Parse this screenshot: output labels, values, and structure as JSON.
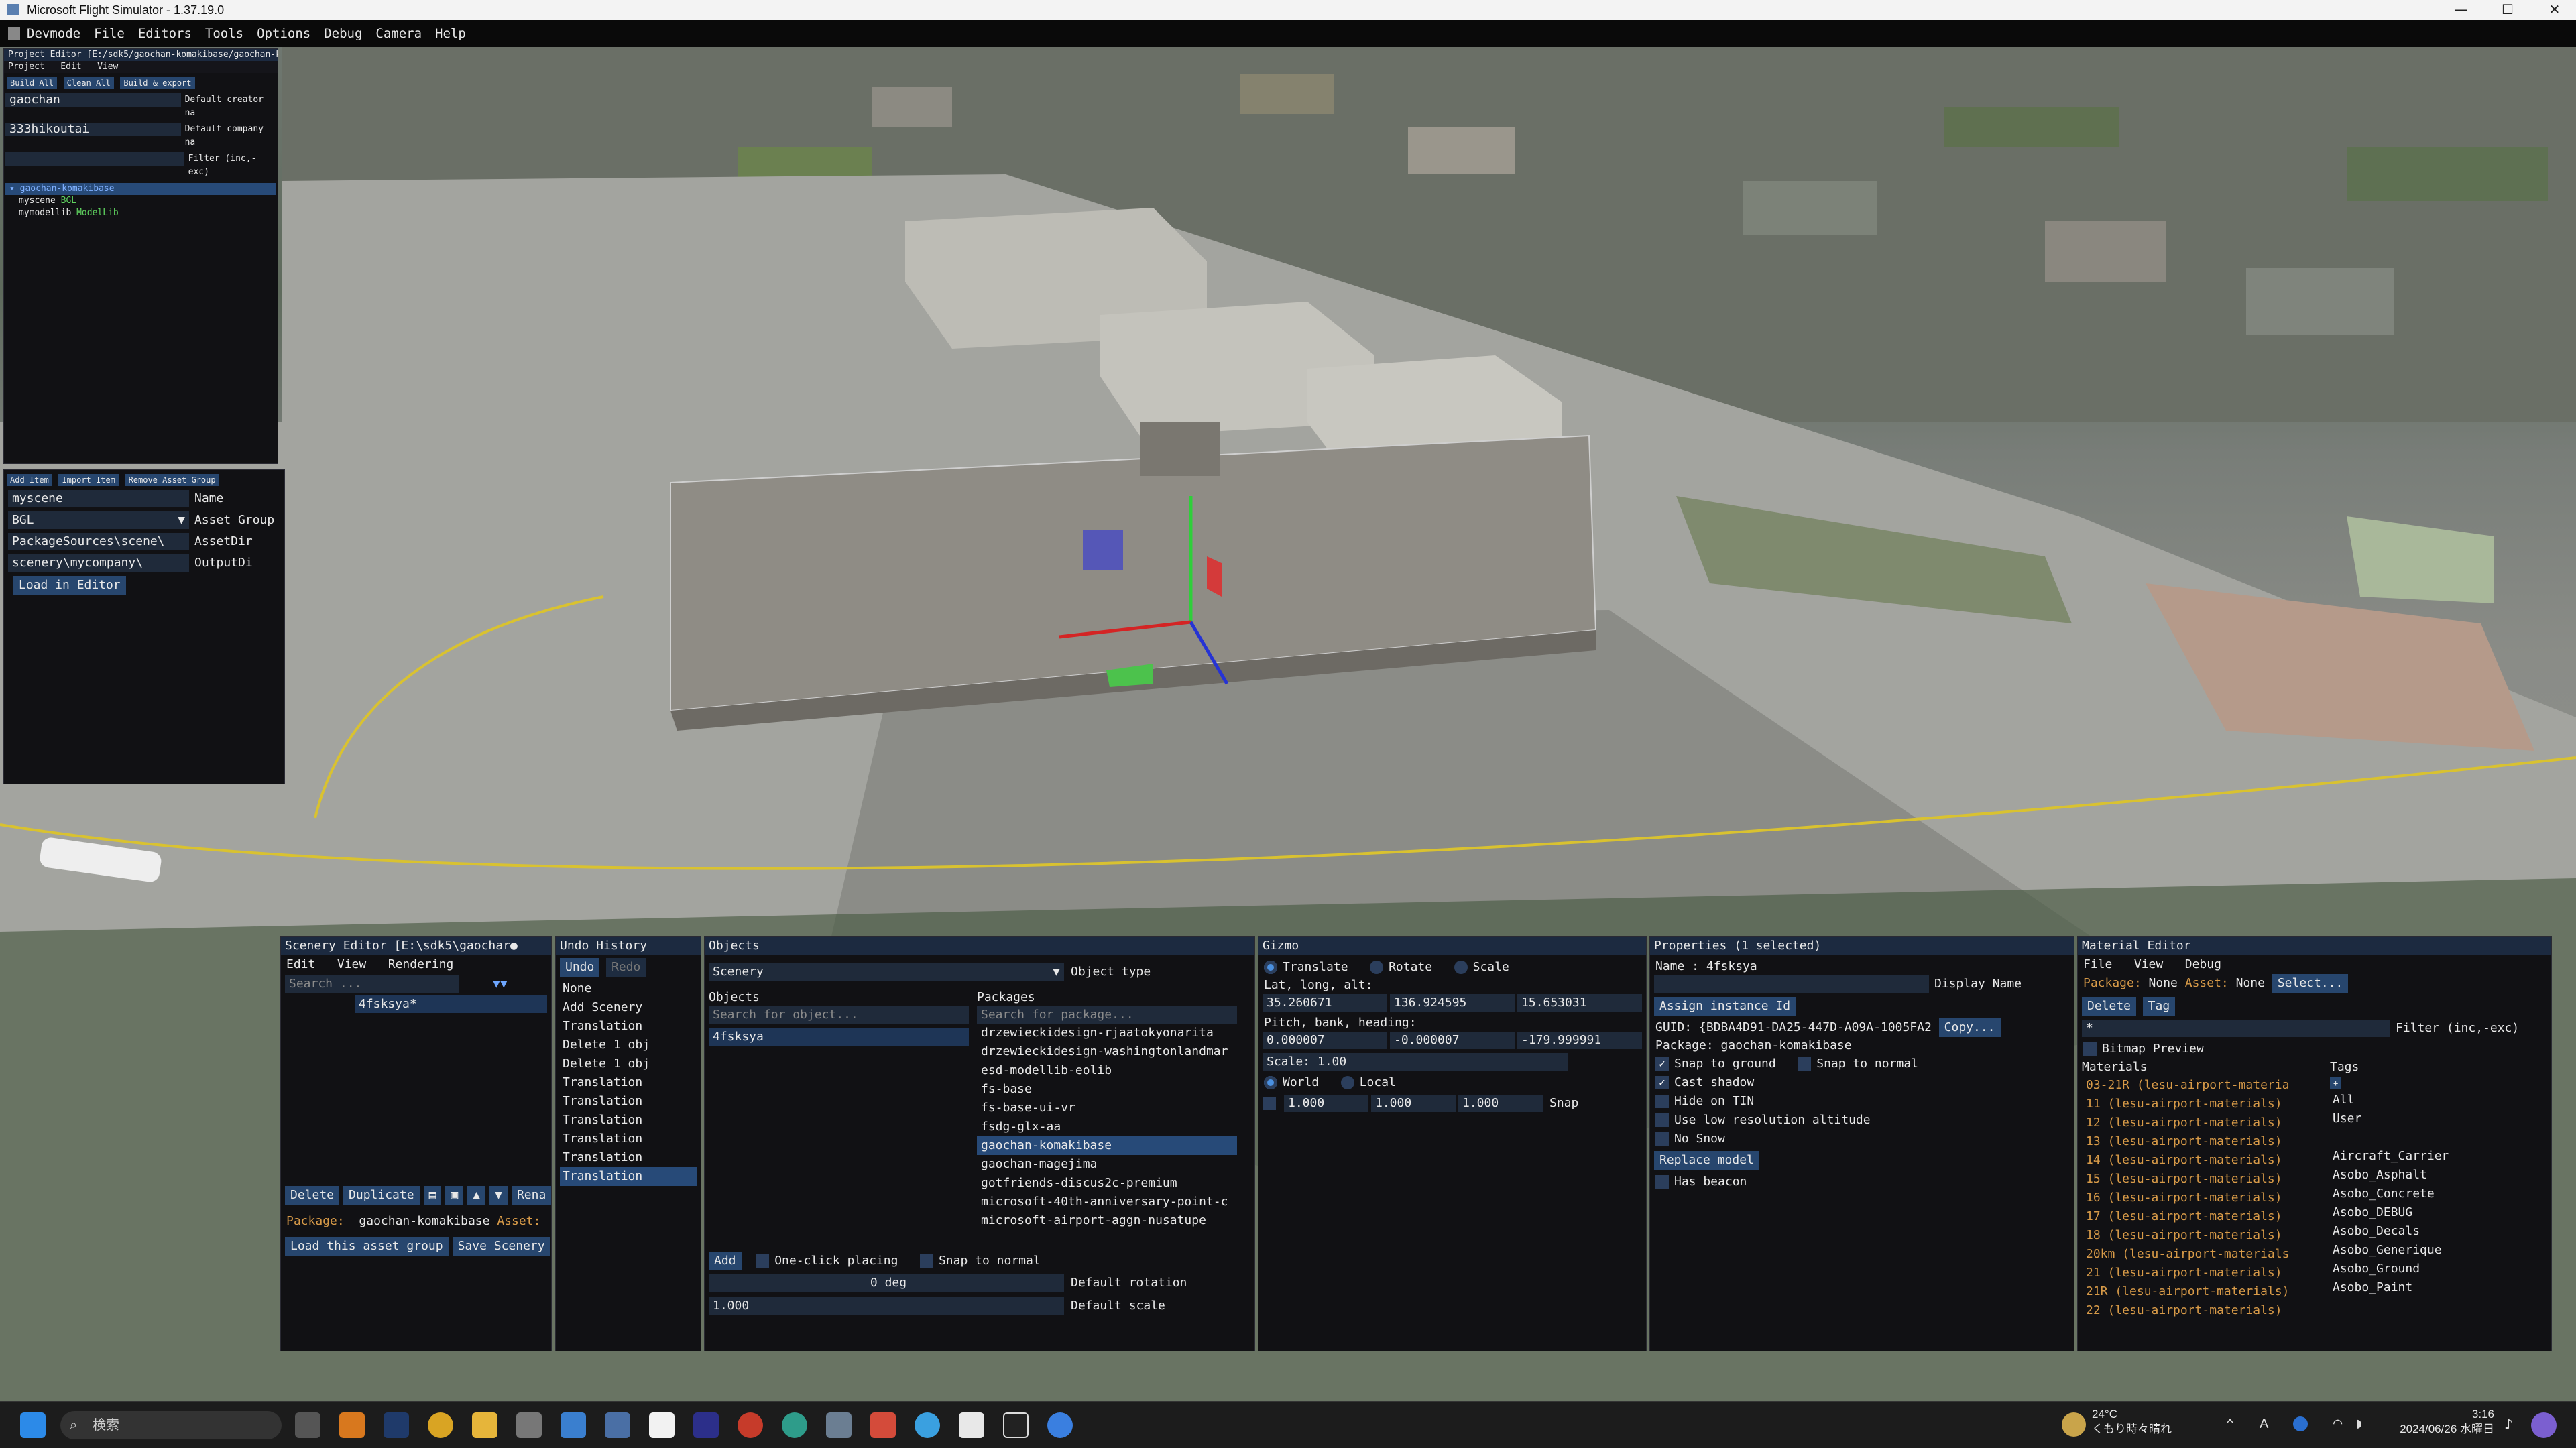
{
  "window": {
    "title": "Microsoft Flight Simulator - 1.37.19.0",
    "min": "—",
    "max": "☐",
    "close": "✕"
  },
  "menu": [
    "Devmode",
    "File",
    "Editors",
    "Tools",
    "Options",
    "Debug",
    "Camera",
    "Help"
  ],
  "project_editor": {
    "title": "Project Editor [E:/sdk5/gaochan-komakibase/gaochan-k",
    "menu": [
      "Project",
      "Edit",
      "View"
    ],
    "buttons": [
      "Build All",
      "Clean All",
      "Build & export"
    ],
    "fields": [
      {
        "value": "gaochan",
        "label": "Default creator na"
      },
      {
        "value": "333hikoutai",
        "label": "Default company na"
      },
      {
        "value": "",
        "label": "Filter (inc,-exc)"
      }
    ],
    "tree": [
      {
        "label": "gaochan-komakibase",
        "tag": ""
      },
      {
        "label": "myscene",
        "tag": "BGL"
      },
      {
        "label": "mymodellib",
        "tag": "ModelLib"
      }
    ],
    "asset_buttons": [
      "Add Item",
      "Import Item",
      "Remove Asset Group"
    ],
    "asset_fields": [
      {
        "value": "myscene",
        "label": "Name"
      },
      {
        "value": "BGL",
        "label": "Asset Group"
      },
      {
        "value": "PackageSources\\scene\\",
        "label": "AssetDir"
      },
      {
        "value": "scenery\\mycompany\\",
        "label": "OutputDi"
      }
    ],
    "load_button": "Load in Editor"
  },
  "scenery_editor": {
    "title": "Scenery Editor [E:\\sdk5\\gaochar●",
    "menu": [
      "Edit",
      "View",
      "Rendering"
    ],
    "search_placeholder": "Search ...",
    "item": "4fsksya*",
    "buttons": [
      "Delete",
      "Duplicate",
      "Rena"
    ],
    "package_label": "Package:",
    "package": "gaochan-komakibase",
    "asset_label": "Asset:",
    "load_button": "Load this asset group",
    "save_button": "Save Scenery"
  },
  "undo_history": {
    "title": "Undo History",
    "undo": "Undo",
    "redo": "Redo",
    "items": [
      "None",
      "Add Scenery",
      "Translation",
      "Delete 1 obj",
      "Delete 1 obj",
      "Translation",
      "Translation",
      "Translation",
      "Translation",
      "Translation",
      "Translation"
    ]
  },
  "objects": {
    "title": "Objects",
    "type_value": "Scenery",
    "type_label": "Object type",
    "objects_header": "Objects",
    "packages_header": "Packages",
    "obj_search": "Search for object...",
    "pkg_search": "Search for package...",
    "objects_list": [
      "4fsksya"
    ],
    "packages": [
      "drzewieckidesign-rjaatokyonarita",
      "drzewieckidesign-washingtonlandmar",
      "esd-modellib-eolib",
      "fs-base",
      "fs-base-ui-vr",
      "fsdg-glx-aa",
      "gaochan-komakibase",
      "gaochan-magejima",
      "gotfriends-discus2c-premium",
      "microsoft-40th-anniversary-point-c",
      "microsoft-airport-aggn-nusatupe"
    ],
    "add": "Add",
    "one_click": "One-click placing",
    "snap_normal": "Snap to normal",
    "rotation_value": "0 deg",
    "rotation_label": "Default rotation",
    "scale_value": "1.000",
    "scale_label": "Default scale"
  },
  "gizmo": {
    "title": "Gizmo",
    "modes": [
      "Translate",
      "Rotate",
      "Scale"
    ],
    "lla_label": "Lat, long, alt:",
    "lla": [
      "35.260671",
      "136.924595",
      "15.653031"
    ],
    "pbh_label": "Pitch, bank, heading:",
    "pbh": [
      "0.000007",
      "-0.000007",
      "-179.999991"
    ],
    "scale": "Scale: 1.00",
    "spaces": [
      "World",
      "Local"
    ],
    "snap": [
      "1.000",
      "1.000",
      "1.000"
    ],
    "snap_label": "Snap"
  },
  "properties": {
    "title": "Properties (1 selected)",
    "name": "Name : 4fsksya",
    "display_label": "Display Name",
    "assign_button": "Assign instance Id",
    "guid": "GUID: {BDBA4D91-DA25-447D-A09A-1005FA2",
    "copy_button": "Copy...",
    "package": "Package: gaochan-komakibase",
    "snap_ground": "Snap to ground",
    "snap_normal": "Snap to normal",
    "checks": [
      "Cast shadow",
      "Hide on TIN",
      "Use low resolution altitude",
      "No Snow"
    ],
    "replace": "Replace model",
    "beacon": "Has beacon"
  },
  "material_editor": {
    "title": "Material Editor",
    "menu": [
      "File",
      "View",
      "Debug"
    ],
    "package_label": "Package:",
    "package": "None",
    "asset_label": "Asset:",
    "asset": "None",
    "select_button": "Select...",
    "delete": "Delete",
    "tag": "Tag",
    "filter_value": "*",
    "filter_label": "Filter (inc,-exc)",
    "bitmap": "Bitmap Preview",
    "materials_header": "Materials",
    "tags_header": "Tags",
    "materials": [
      "03-21R (lesu-airport-materia",
      "11 (lesu-airport-materials)",
      "12 (lesu-airport-materials)",
      "13 (lesu-airport-materials)",
      "14 (lesu-airport-materials)",
      "15 (lesu-airport-materials)",
      "16 (lesu-airport-materials)",
      "17 (lesu-airport-materials)",
      "18 (lesu-airport-materials)",
      "20km (lesu-airport-materials",
      "21 (lesu-airport-materials)",
      "21R (lesu-airport-materials)",
      "22 (lesu-airport-materials)"
    ],
    "tags": [
      "All",
      "User",
      "",
      "Aircraft_Carrier",
      "Asobo_Asphalt",
      "Asobo_Concrete",
      "Asobo_DEBUG",
      "Asobo_Decals",
      "Asobo_Generique",
      "Asobo_Ground",
      "Asobo_Paint"
    ]
  },
  "taskbar": {
    "search": "検索",
    "temp": "24°C",
    "weather": "くもり時々晴れ",
    "time": "3:16",
    "date": "2024/06/26 水曜日",
    "ime": "A"
  },
  "colors": {
    "panel_header": "#1c2a40",
    "button": "#27466e",
    "accent": "#4a90e0",
    "material_text": "#d79a48"
  }
}
